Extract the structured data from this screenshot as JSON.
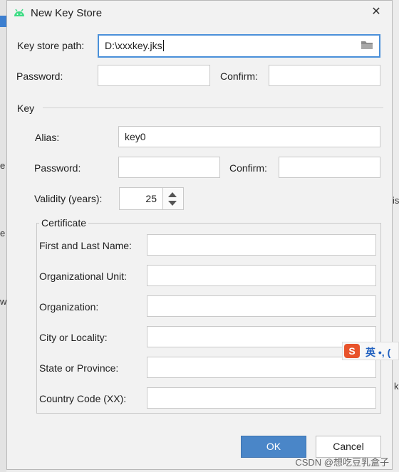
{
  "dialog": {
    "title": "New Key Store",
    "close_symbol": "✕"
  },
  "keystore": {
    "path_label": "Key store path:",
    "path_value": "D:\\xxxkey.jks",
    "password_label": "Password:",
    "confirm_label": "Confirm:"
  },
  "key": {
    "section_label": "Key",
    "alias_label": "Alias:",
    "alias_value": "key0",
    "password_label": "Password:",
    "confirm_label": "Confirm:",
    "validity_label": "Validity (years):",
    "validity_value": "25"
  },
  "certificate": {
    "title": "Certificate",
    "fields": [
      {
        "label": "First and Last Name:",
        "value": ""
      },
      {
        "label": "Organizational Unit:",
        "value": ""
      },
      {
        "label": "Organization:",
        "value": ""
      },
      {
        "label": "City or Locality:",
        "value": ""
      },
      {
        "label": "State or Province:",
        "value": ""
      },
      {
        "label": "Country Code (XX):",
        "value": ""
      }
    ]
  },
  "buttons": {
    "ok": "OK",
    "cancel": "Cancel"
  },
  "ime": {
    "logo": "S",
    "text": "英 •, ("
  },
  "watermark": "CSDN @想吃豆乳盒子",
  "background": {
    "frag1": "e",
    "frag2": "e",
    "frag3": "w",
    "frag4": "is",
    "frag5": "k"
  },
  "colors": {
    "accent": "#4a86c8",
    "focus_border": "#4a90d9",
    "android_green": "#3ddc84",
    "ime_orange": "#e8532b"
  },
  "icons": {
    "app": "android-icon",
    "folder": "folder-icon",
    "close": "close-icon"
  }
}
